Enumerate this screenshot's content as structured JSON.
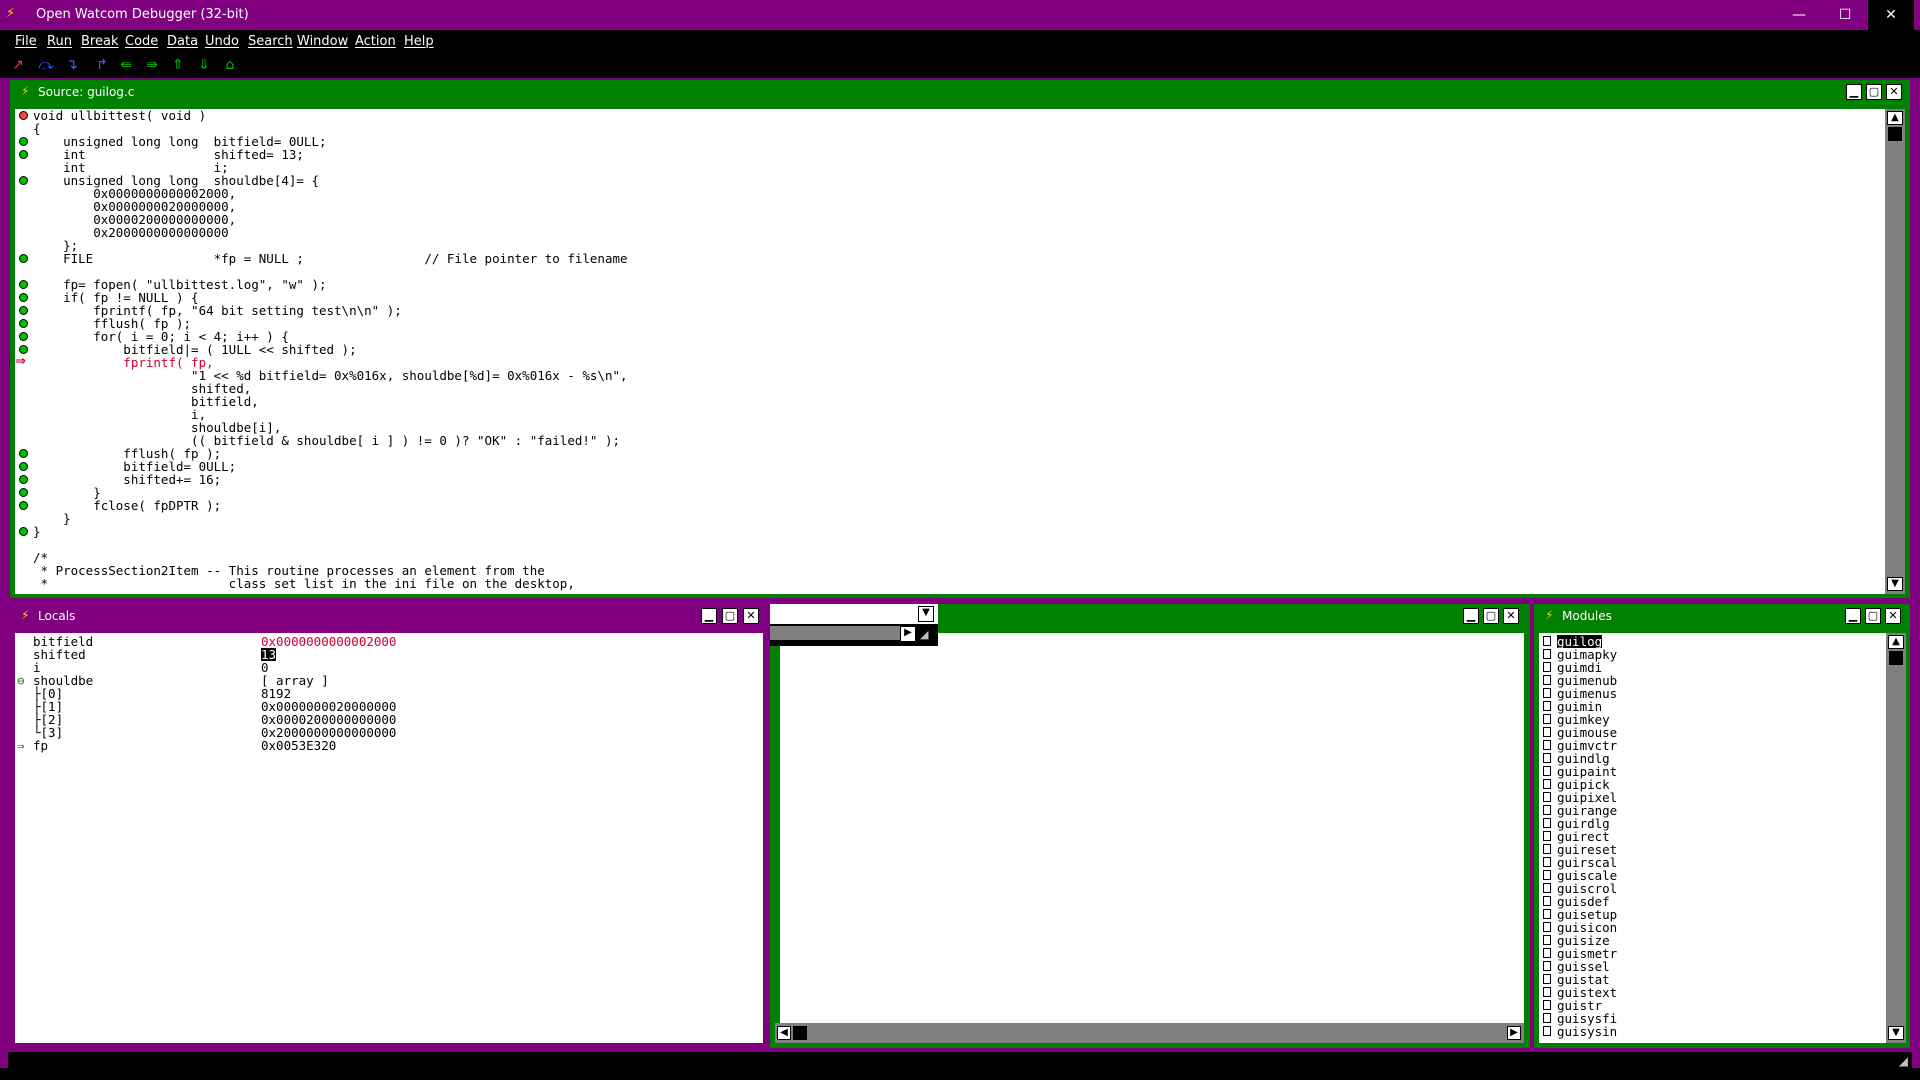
{
  "app": {
    "title": "Open Watcom Debugger (32-bit)",
    "controls": {
      "minimize": "—",
      "maximize": "☐",
      "close": "✕"
    }
  },
  "menu": [
    "File",
    "Run",
    "Break",
    "Code",
    "Data",
    "Undo",
    "Search",
    "Window",
    "Action",
    "Help"
  ],
  "toolbar_icons": [
    "go-icon",
    "step-over-icon",
    "trace-into-icon",
    "return-icon",
    "undo-icon",
    "redo-icon",
    "up-stack-icon",
    "down-stack-icon",
    "home-icon"
  ],
  "colors": {
    "frame": "#800080",
    "active_title": "#008000",
    "client": "#ffffff",
    "breakpoint": "#00c000",
    "highlight": "#cc0033"
  },
  "source": {
    "title": "Source: guilog.c",
    "lines": [
      "void ullbittest( void )",
      "{",
      "    unsigned long long  bitfield= 0ULL;",
      "    int                 shifted= 13;",
      "    int                 i;",
      "    unsigned long long  shouldbe[4]= {",
      "        0x0000000000002000,",
      "        0x0000000020000000,",
      "        0x0000200000000000,",
      "        0x2000000000000000",
      "    };",
      "    FILE                *fp = NULL ;                // File pointer to filename",
      "",
      "    fp= fopen( \"ullbittest.log\", \"w\" );",
      "    if( fp != NULL ) {",
      "        fprintf( fp, \"64 bit setting test\\n\\n\" );",
      "        fflush( fp );",
      "        for( i = 0; i < 4; i++ ) {",
      "            bitfield|= ( 1ULL << shifted );",
      "            fprintf( fp,",
      "                     \"1 << %d bitfield= 0x%016x, shouldbe[%d]= 0x%016x - %s\\n\",",
      "                     shifted,",
      "                     bitfield,",
      "                     i,",
      "                     shouldbe[i],",
      "                     (( bitfield & shouldbe[ i ] ) != 0 )? \"OK\" : \"failed!\" );",
      "            fflush( fp );",
      "            bitfield= 0ULL;",
      "            shifted+= 16;",
      "        }",
      "        fclose( fpDPTR );",
      "    }",
      "}",
      "",
      "/*",
      " * ProcessSection2Item -- This routine processes an element from the",
      " *                        class set list in the ini file on the desktop,"
    ],
    "current_line": 19
  },
  "locals": {
    "title": "Locals",
    "rows": [
      {
        "name": "bitfield",
        "value": "0x0000000000002000",
        "changed": true
      },
      {
        "name": "shifted",
        "value": "13",
        "selected": true
      },
      {
        "name": "i",
        "value": "0"
      },
      {
        "name": "shouldbe",
        "value": "[ array ]",
        "expanded": true
      },
      {
        "name": "├[0]",
        "value": "8192"
      },
      {
        "name": "├[1]",
        "value": "0x0000000020000000"
      },
      {
        "name": "├[2]",
        "value": "0x0000200000000000"
      },
      {
        "name": "└[3]",
        "value": "0x2000000000000000"
      },
      {
        "name": "fp",
        "value": "0x0053E320",
        "pointer": true
      }
    ]
  },
  "modules": {
    "title": "Modules",
    "items": [
      "guilog",
      "guimapky",
      "guimdi",
      "guimenub",
      "guimenus",
      "guimin",
      "guimkey",
      "guimouse",
      "guimvctr",
      "guindlg",
      "guipaint",
      "guipick",
      "guipixel",
      "guirange",
      "guirdlg",
      "guirect",
      "guireset",
      "guirscal",
      "guiscale",
      "guiscrol",
      "guisdef",
      "guisetup",
      "guisicon",
      "guisize",
      "guismetr",
      "guissel",
      "guistat",
      "guistext",
      "guistr",
      "guisysfi",
      "guisysin"
    ]
  }
}
